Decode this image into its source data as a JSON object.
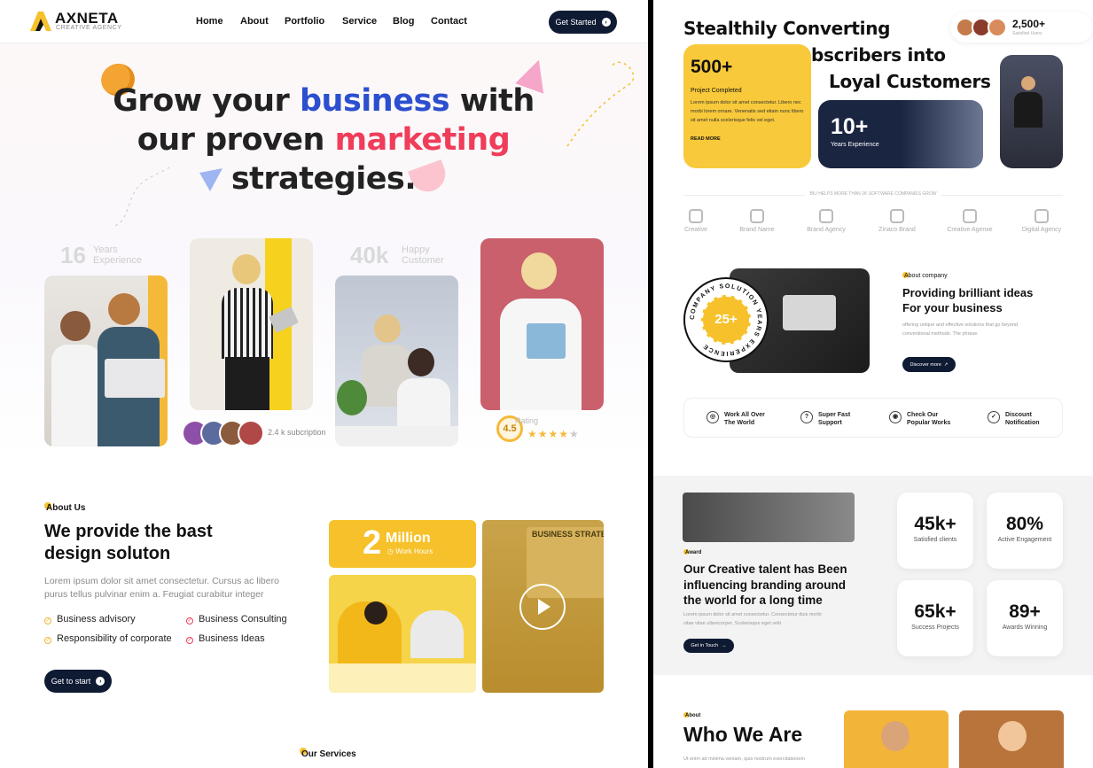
{
  "colors": {
    "navy": "#0f1a33",
    "yellow": "#f6c12a",
    "blue": "#2b4fcf",
    "red": "#ef3d5a"
  },
  "nav": {
    "brand": "AXNETA",
    "brand_sub": "CREATIVE AGENCY",
    "items": [
      "Home",
      "About",
      "Portfolio",
      "Service",
      "Blog",
      "Contact"
    ],
    "cta": "Get Started"
  },
  "hero": {
    "line1a": "Grow your ",
    "line1b": "business",
    "line1c": " with",
    "line2a": "our proven ",
    "line2b": "marketing",
    "line3": "strategies."
  },
  "stats": {
    "years_num": "16",
    "years_label1": "Years",
    "years_label2": "Experience",
    "happy_num": "40k",
    "happy_label1": "Happy",
    "happy_label2": "Customer",
    "subs": "2.4 k subcription",
    "rating_label": "Rating",
    "rating": "4.5",
    "stars": 4
  },
  "about": {
    "tag": "About Us",
    "title1": "We provide the bast",
    "title2": "design soluton",
    "text1": "Lorem ipsum dolor sit amet consectetur. Cursus ac libero",
    "text2": "purus tellus pulvinar enim a. Feugiat curabitur integer",
    "checks": [
      "Business advisory",
      "Business Consulting",
      "Responsibility of corporate",
      "Business Ideas"
    ],
    "cta": "Get to start",
    "million_num": "2",
    "million_word": "Million",
    "million_sub": "Work Hours",
    "screen_text": "BUSINESS STRATEG"
  },
  "services_tag": "Our Services",
  "right": {
    "title1": "Stealthily Converting",
    "title2": "Subscribers into",
    "title3": "Loyal Customers",
    "subs_num": "2,500+",
    "subs_label": "Satisfied Users",
    "proj_num": "500+",
    "proj_label": "Project Completed",
    "proj_text": "Lorem ipsum dolor sit amet consectetur. Libero nec morbi lorem ornare. Venenatis sed etiam nunc libero sit amet nulla scelerisque felis vel eget.",
    "read_more": "READ MORE",
    "years_num": "10+",
    "years_label": "Years Experience",
    "brands_caption": "BIU HELPS MORE THAN 2K SOFTWARE COMPANIES GROW",
    "brands": [
      "Creative",
      "Brand Name",
      "Brand Agency",
      "Zinaco Brand",
      "Creative Agenxe",
      "Digital Agency"
    ],
    "badge_num": "25+",
    "badge_ring": "COMPANY SOLUTION YEARS EXPERIENCE",
    "about_tag": "About company",
    "about_title1": "Providing brilliant ideas",
    "about_title2": "For your business",
    "about_text1": "offering unique and effective solutions that go beyond",
    "about_text2": "conventional methods. The phrase.",
    "discover": "Discover more",
    "features": [
      [
        "Work All Over",
        "The World"
      ],
      [
        "Super Fast",
        "Support"
      ],
      [
        "Check Our",
        "Popular Works"
      ],
      [
        "Discount",
        "Notification"
      ]
    ],
    "award_tag": "Award",
    "award_title1": "Our Creative talent has Been",
    "award_title2": "influencing branding around",
    "award_title3": "the world for a long time",
    "award_text1": "Lorem ipsum dolor sit amet consectetur. Consectetur duis morbi",
    "award_text2": "vitae vitae ullamcorper. Scelerisque eget velit",
    "award_cta": "Get in Touch",
    "stat_boxes": [
      [
        "45k+",
        "Satisfied clients"
      ],
      [
        "80%",
        "Active Engagement"
      ],
      [
        "65k+",
        "Success Projects"
      ],
      [
        "89+",
        "Awards Winning"
      ]
    ],
    "who_tag": "About",
    "who_title": "Who We Are",
    "who_text": "Ut enim ad minima veniam, quis nostrum exercitationem"
  }
}
